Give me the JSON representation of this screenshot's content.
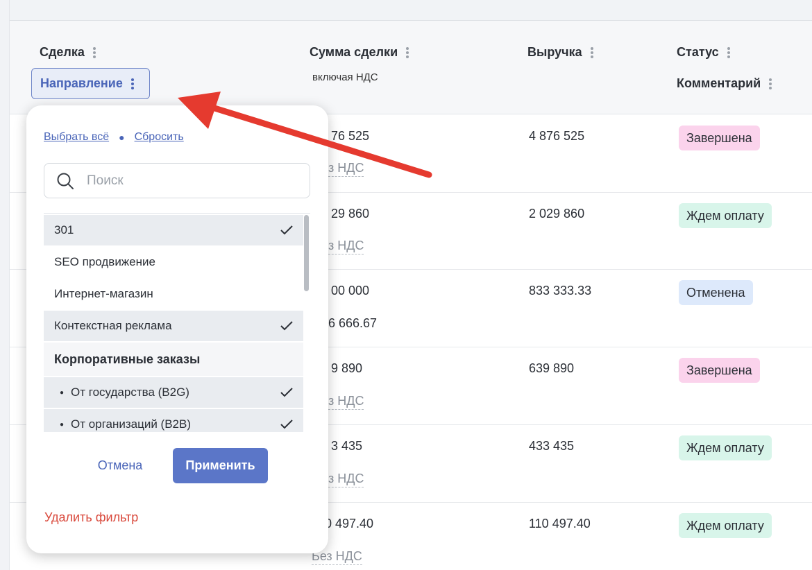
{
  "columns": {
    "deal": "Сделка",
    "direction": "Направление",
    "amount": "Сумма сделки",
    "amount_sub": "включая НДС",
    "revenue": "Выручка",
    "status": "Статус",
    "comment": "Комментарий"
  },
  "rows": [
    {
      "amount": "76 525",
      "amount_sub": "з НДС",
      "revenue": "4 876 525",
      "status": "Завершена",
      "status_kind": "done"
    },
    {
      "amount": "29 860",
      "amount_sub": "з НДС",
      "revenue": "2 029 860",
      "status": "Ждем оплату",
      "status_kind": "wait"
    },
    {
      "amount": "00 000",
      "amount_sub": "6 666.67",
      "revenue": "833 333.33",
      "status": "Отменена",
      "status_kind": "cancel"
    },
    {
      "amount": "9 890",
      "amount_sub": "з НДС",
      "revenue": "639 890",
      "status": "Завершена",
      "status_kind": "done"
    },
    {
      "amount": "3 435",
      "amount_sub": "з НДС",
      "revenue": "433 435",
      "status": "Ждем оплату",
      "status_kind": "wait"
    },
    {
      "amount": "0 497.40",
      "amount_sub": "Без НДС",
      "revenue": "110 497.40",
      "status": "Ждем оплату",
      "status_kind": "wait"
    }
  ],
  "filter": {
    "select_all": "Выбрать всё",
    "reset": "Сбросить",
    "search_placeholder": "Поиск",
    "items": [
      {
        "label": "301",
        "selected": true
      },
      {
        "label": "SEO продвижение",
        "selected": false
      },
      {
        "label": "Интернет-магазин",
        "selected": false
      },
      {
        "label": "Контекстная реклама",
        "selected": true
      },
      {
        "label": "Корпоративные заказы",
        "group": true
      },
      {
        "label": "От государства (B2G)",
        "selected": true,
        "child": true
      },
      {
        "label": "От организаций (B2B)",
        "selected": true,
        "child": true
      }
    ],
    "cancel": "Отмена",
    "apply": "Применить",
    "remove": "Удалить фильтр"
  },
  "colors": {
    "accent": "#5b76c8",
    "danger": "#d9483b",
    "annotation_arrow": "#e53a2f"
  }
}
